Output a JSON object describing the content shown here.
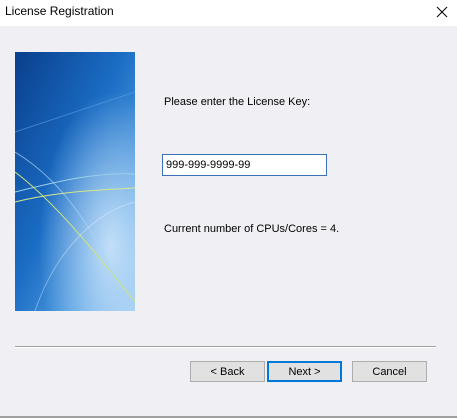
{
  "window": {
    "title": "License Registration",
    "close_icon": "close-icon"
  },
  "content": {
    "prompt": "Please enter the License Key:",
    "license_key_value": "999-999-9999-99",
    "cpu_info": "Current number of CPUs/Cores = 4."
  },
  "buttons": {
    "back_label": "< Back",
    "next_label": "Next >",
    "cancel_label": "Cancel"
  },
  "colors": {
    "banner_dark": "#0b4a9a",
    "banner_light": "#8ec3f0",
    "focus_border": "#0078d7"
  }
}
